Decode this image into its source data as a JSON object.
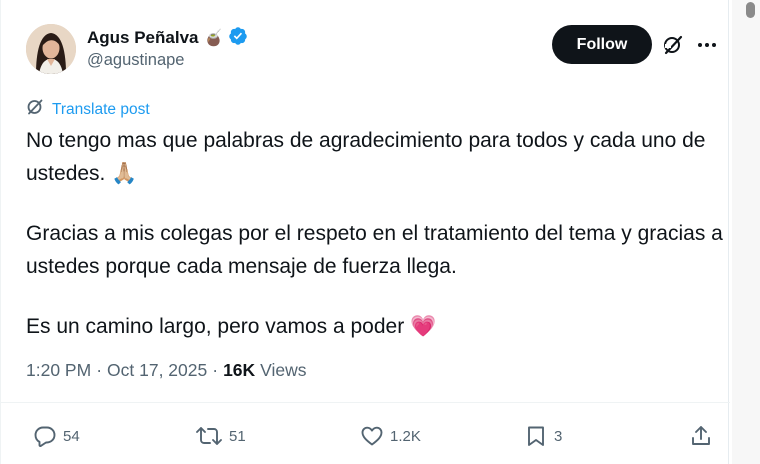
{
  "author": {
    "display_name": "Agus Peñalva",
    "name_emoji": "🧉",
    "handle": "@agustinape",
    "verified": true
  },
  "header": {
    "follow_label": "Follow",
    "grok_icon": "grok-icon",
    "more_icon": "more-icon"
  },
  "translate": {
    "label": "Translate post"
  },
  "tweet": {
    "paragraphs": [
      "No tengo mas que palabras de agradecimiento para todos y cada uno de ustedes. 🙏🏼",
      "Gracias a mis colegas por el respeto en el tratamiento del tema y gracias a ustedes porque cada mensaje de fuerza llega.",
      "Es un camino largo, pero vamos a poder 💗"
    ]
  },
  "meta": {
    "time": "1:20 PM",
    "separator": "·",
    "date": "Oct 17, 2025",
    "views_count": "16K",
    "views_label": "Views"
  },
  "actions": {
    "replies": "54",
    "reposts": "51",
    "likes": "1.2K",
    "bookmarks": "3"
  },
  "colors": {
    "accent": "#1d9bf0",
    "follow_bg": "#0f1419",
    "secondary_text": "#536471"
  }
}
